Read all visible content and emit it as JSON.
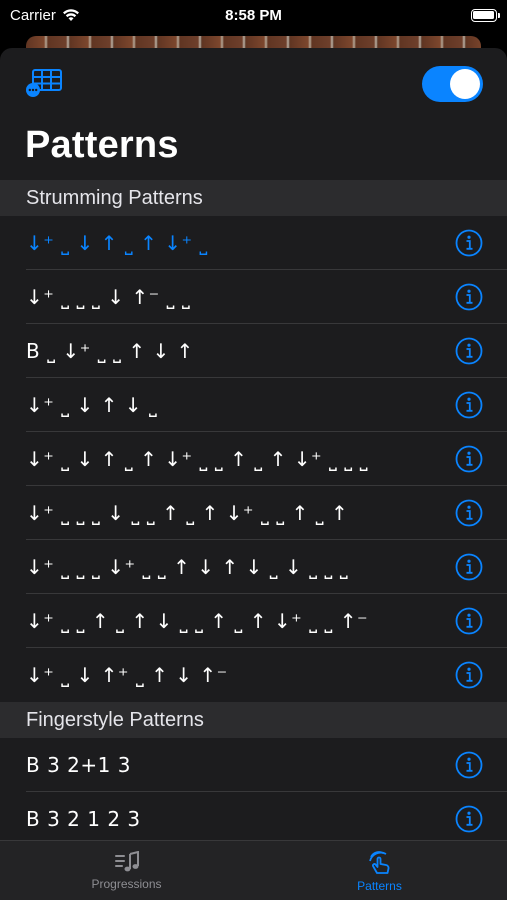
{
  "status_bar": {
    "carrier": "Carrier",
    "time": "8:58 PM"
  },
  "header": {
    "title": "Patterns",
    "toggle_on": true,
    "accent_color": "#0a84ff"
  },
  "sections": [
    {
      "title": "Strumming Patterns",
      "rows": [
        {
          "pattern": "↓⁺ ⎵ ↓ ↑ ⎵ ↑ ↓⁺ ⎵",
          "selected": true
        },
        {
          "pattern": "↓⁺ ⎵ ⎵ ⎵ ↓ ↑⁻ ⎵ ⎵",
          "selected": false
        },
        {
          "pattern": "B ⎵ ↓⁺ ⎵ ⎵ ↑ ↓ ↑",
          "selected": false
        },
        {
          "pattern": "↓⁺ ⎵ ↓ ↑ ↓ ⎵",
          "selected": false
        },
        {
          "pattern": "↓⁺ ⎵ ↓ ↑ ⎵ ↑ ↓⁺ ⎵ ⎵ ↑ ⎵ ↑ ↓⁺ ⎵ ⎵ ⎵",
          "selected": false
        },
        {
          "pattern": "↓⁺ ⎵ ⎵ ⎵ ↓ ⎵ ⎵ ↑ ⎵ ↑ ↓⁺ ⎵ ⎵ ↑ ⎵ ↑",
          "selected": false
        },
        {
          "pattern": "↓⁺ ⎵ ⎵ ⎵ ↓⁺ ⎵ ⎵ ↑ ↓ ↑ ↓ ⎵ ↓ ⎵ ⎵ ⎵",
          "selected": false
        },
        {
          "pattern": "↓⁺ ⎵ ⎵ ↑ ⎵ ↑ ↓ ⎵ ⎵ ↑ ⎵ ↑ ↓⁺ ⎵ ⎵ ↑⁻",
          "selected": false
        },
        {
          "pattern": "↓⁺ ⎵ ↓ ↑⁺ ⎵ ↑ ↓ ↑⁻",
          "selected": false
        }
      ]
    },
    {
      "title": "Fingerstyle Patterns",
      "rows": [
        {
          "pattern": "B 3 2+1 3",
          "selected": false
        },
        {
          "pattern": "B 3 2 1 2 3",
          "selected": false
        }
      ]
    }
  ],
  "tabs": [
    {
      "label": "Progressions",
      "active": false,
      "icon": "music-list-icon"
    },
    {
      "label": "Patterns",
      "active": true,
      "icon": "strum-hand-icon"
    }
  ]
}
